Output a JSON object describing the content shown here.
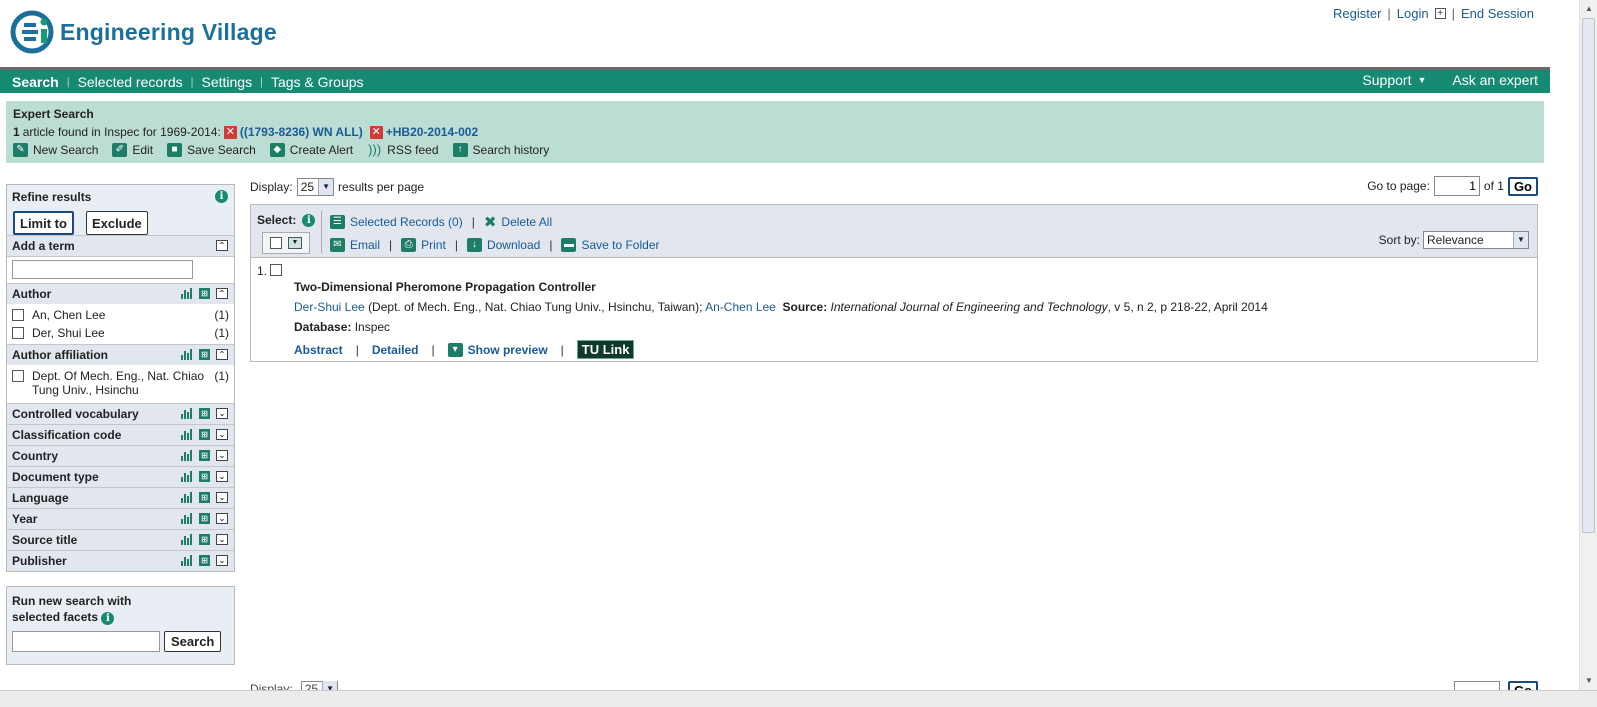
{
  "header": {
    "logo_text": "Engineering Village",
    "links": {
      "register": "Register",
      "login": "Login",
      "plus": "+",
      "end_session": "End Session"
    }
  },
  "nav": {
    "items": [
      "Search",
      "Selected records",
      "Settings",
      "Tags & Groups"
    ],
    "support": "Support",
    "ask": "Ask an expert"
  },
  "summary": {
    "title": "Expert Search",
    "count": "1",
    "found_text": "article found in Inspec for 1969-2014:",
    "query1": "((1793-8236) WN ALL)",
    "query2": "+HB20-2014-002",
    "actions": [
      "New Search",
      "Edit",
      "Save Search",
      "Create Alert",
      "RSS feed",
      "Search history"
    ]
  },
  "refine": {
    "title": "Refine results",
    "limit_label": "Limit to",
    "exclude_label": "Exclude",
    "add_term": "Add a term",
    "author": {
      "label": "Author",
      "items": [
        {
          "name": "An, Chen Lee",
          "count": "(1)"
        },
        {
          "name": "Der, Shui Lee",
          "count": "(1)"
        }
      ]
    },
    "affiliation": {
      "label": "Author affiliation",
      "items": [
        {
          "name": "Dept. Of Mech. Eng., Nat. Chiao Tung Univ., Hsinchu",
          "count": "(1)"
        }
      ]
    },
    "facets": [
      "Controlled vocabulary",
      "Classification code",
      "Country",
      "Document type",
      "Language",
      "Year",
      "Source title",
      "Publisher"
    ]
  },
  "new_search": {
    "title": "Run new search with selected facets",
    "button": "Search"
  },
  "results": {
    "display_label": "Display:",
    "per_page": "25",
    "per_page_suffix": "results per page",
    "goto_label": "Go to page:",
    "page": "1",
    "of_label": "of 1",
    "go": "Go",
    "select_label": "Select:",
    "selected_records": "Selected Records (0)",
    "delete_all": "Delete All",
    "email": "Email",
    "print": "Print",
    "download": "Download",
    "save_folder": "Save to Folder",
    "sort_label": "Sort by:",
    "sort_value": "Relevance",
    "record": {
      "num": "1.",
      "title": "Two-Dimensional Pheromone Propagation Controller",
      "author1": "Der-Shui Lee",
      "affil": "(Dept. of Mech. Eng., Nat. Chiao Tung Univ., Hsinchu, Taiwan);",
      "author2": "An-Chen Lee",
      "source_label": "Source:",
      "journal": "International Journal of Engineering and Technology",
      "citation": ", v 5, n 2, p 218-22, April 2014",
      "db_label": "Database:",
      "db": "Inspec",
      "abstract": "Abstract",
      "detailed": "Detailed",
      "preview": "Show preview",
      "tu_link": "TU Link"
    }
  },
  "colors": {
    "nav": "#168a73",
    "summary_bg": "#bcddd4",
    "brand": "#1b6f9b",
    "link": "#1a5a96"
  }
}
